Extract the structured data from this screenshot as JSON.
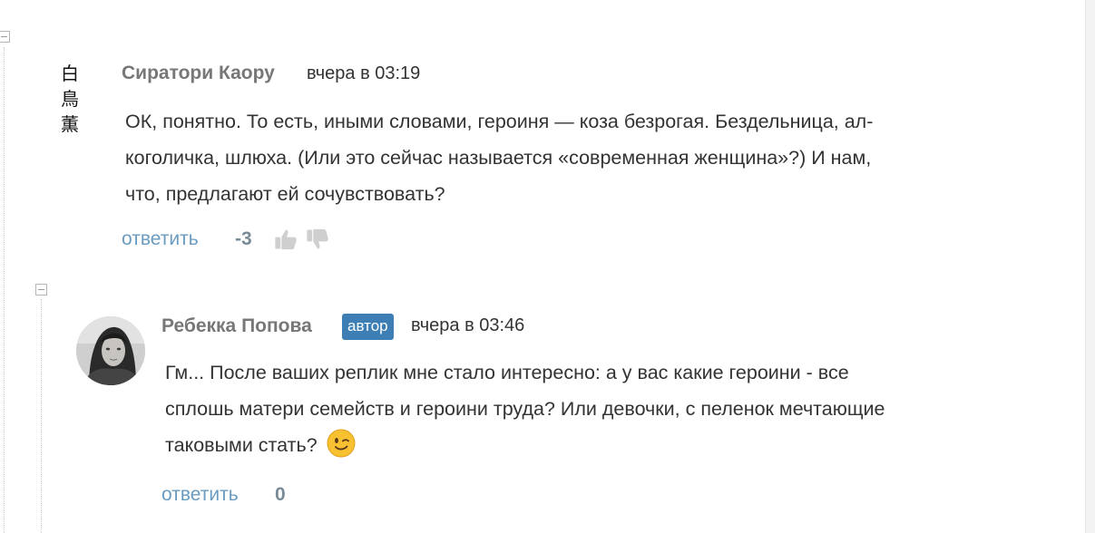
{
  "comments": [
    {
      "author": "Сиратори Каору",
      "avatar_glyphs": [
        "白",
        "鳥",
        "薫"
      ],
      "time": "вчера в 03:19",
      "text_lines": [
        "ОК, понятно. То есть, иными словами, героиня — коза безрогая. Бездельница, ал-",
        "коголичка, шлюха. (Или это сейчас называется «современная женщина»?) И нам,",
        "что, предлагают ей сочувствовать?"
      ],
      "reply_label": "ответить",
      "score": "-3",
      "icons": [
        "thumbs-up-icon",
        "thumbs-down-icon"
      ]
    },
    {
      "author": "Ребекка Попова",
      "badge": "автор",
      "time": "вчера в 03:46",
      "text_lines": [
        "Гм... После ваших реплик мне стало интересно: а у вас какие героини - все",
        "сплошь матери семейств и героини труда? Или девочки, с пеленок мечтающие",
        "таковыми стать?"
      ],
      "emoji": "winking-face-emoji",
      "reply_label": "ответить",
      "score": "0"
    }
  ],
  "colors": {
    "author": "#777777",
    "link": "#6a9bc1",
    "score": "#7a8b98",
    "badge_bg": "#3d7fb5",
    "text": "#333333"
  }
}
